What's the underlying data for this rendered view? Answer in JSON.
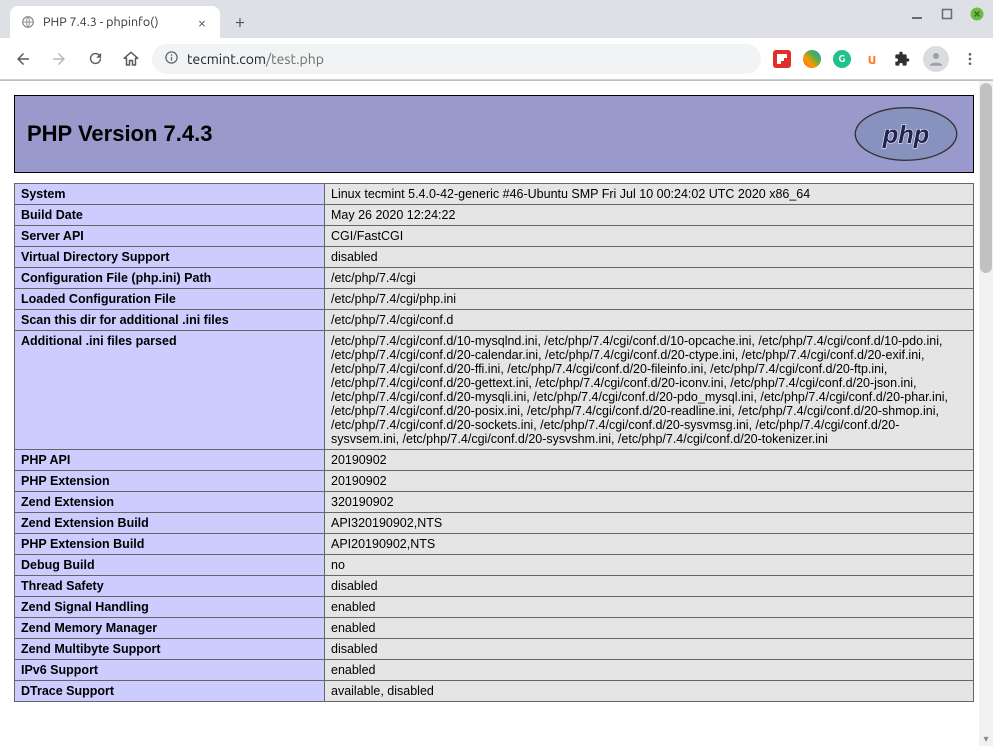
{
  "browser": {
    "tab_title": "PHP 7.4.3 - phpinfo()",
    "new_tab_label": "+",
    "url_host": "tecmint.com",
    "url_path": "/test.php"
  },
  "page": {
    "header_title": "PHP Version 7.4.3",
    "rows": [
      {
        "label": "System",
        "value": "Linux tecmint 5.4.0-42-generic #46-Ubuntu SMP Fri Jul 10 00:24:02 UTC 2020 x86_64"
      },
      {
        "label": "Build Date",
        "value": "May 26 2020 12:24:22"
      },
      {
        "label": "Server API",
        "value": "CGI/FastCGI"
      },
      {
        "label": "Virtual Directory Support",
        "value": "disabled"
      },
      {
        "label": "Configuration File (php.ini) Path",
        "value": "/etc/php/7.4/cgi"
      },
      {
        "label": "Loaded Configuration File",
        "value": "/etc/php/7.4/cgi/php.ini"
      },
      {
        "label": "Scan this dir for additional .ini files",
        "value": "/etc/php/7.4/cgi/conf.d"
      },
      {
        "label": "Additional .ini files parsed",
        "value": "/etc/php/7.4/cgi/conf.d/10-mysqlnd.ini, /etc/php/7.4/cgi/conf.d/10-opcache.ini, /etc/php/7.4/cgi/conf.d/10-pdo.ini, /etc/php/7.4/cgi/conf.d/20-calendar.ini, /etc/php/7.4/cgi/conf.d/20-ctype.ini, /etc/php/7.4/cgi/conf.d/20-exif.ini, /etc/php/7.4/cgi/conf.d/20-ffi.ini, /etc/php/7.4/cgi/conf.d/20-fileinfo.ini, /etc/php/7.4/cgi/conf.d/20-ftp.ini, /etc/php/7.4/cgi/conf.d/20-gettext.ini, /etc/php/7.4/cgi/conf.d/20-iconv.ini, /etc/php/7.4/cgi/conf.d/20-json.ini, /etc/php/7.4/cgi/conf.d/20-mysqli.ini, /etc/php/7.4/cgi/conf.d/20-pdo_mysql.ini, /etc/php/7.4/cgi/conf.d/20-phar.ini, /etc/php/7.4/cgi/conf.d/20-posix.ini, /etc/php/7.4/cgi/conf.d/20-readline.ini, /etc/php/7.4/cgi/conf.d/20-shmop.ini, /etc/php/7.4/cgi/conf.d/20-sockets.ini, /etc/php/7.4/cgi/conf.d/20-sysvmsg.ini, /etc/php/7.4/cgi/conf.d/20-sysvsem.ini, /etc/php/7.4/cgi/conf.d/20-sysvshm.ini, /etc/php/7.4/cgi/conf.d/20-tokenizer.ini"
      },
      {
        "label": "PHP API",
        "value": "20190902"
      },
      {
        "label": "PHP Extension",
        "value": "20190902"
      },
      {
        "label": "Zend Extension",
        "value": "320190902"
      },
      {
        "label": "Zend Extension Build",
        "value": "API320190902,NTS"
      },
      {
        "label": "PHP Extension Build",
        "value": "API20190902,NTS"
      },
      {
        "label": "Debug Build",
        "value": "no"
      },
      {
        "label": "Thread Safety",
        "value": "disabled"
      },
      {
        "label": "Zend Signal Handling",
        "value": "enabled"
      },
      {
        "label": "Zend Memory Manager",
        "value": "enabled"
      },
      {
        "label": "Zend Multibyte Support",
        "value": "disabled"
      },
      {
        "label": "IPv6 Support",
        "value": "enabled"
      },
      {
        "label": "DTrace Support",
        "value": "available, disabled"
      }
    ]
  }
}
